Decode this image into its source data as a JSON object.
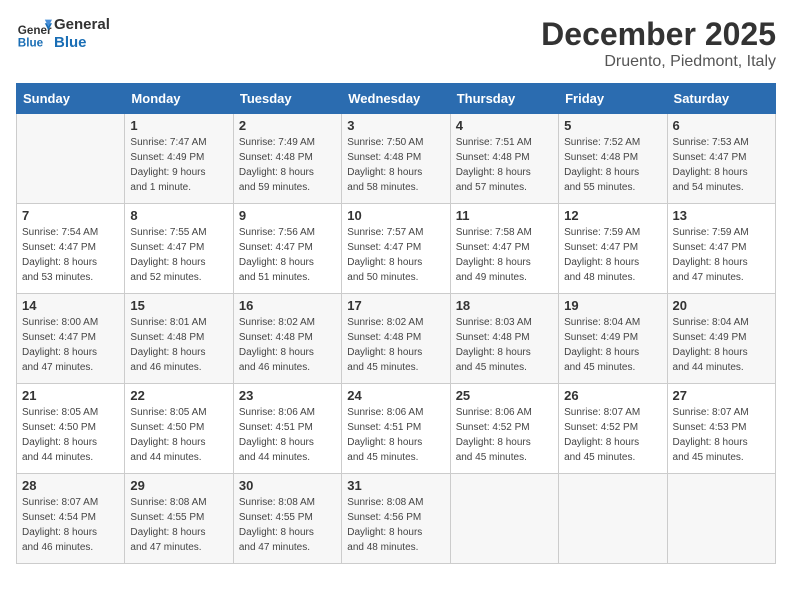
{
  "header": {
    "logo_text_general": "General",
    "logo_text_blue": "Blue",
    "month_title": "December 2025",
    "location": "Druento, Piedmont, Italy"
  },
  "days_of_week": [
    "Sunday",
    "Monday",
    "Tuesday",
    "Wednesday",
    "Thursday",
    "Friday",
    "Saturday"
  ],
  "weeks": [
    [
      {
        "day": "",
        "info": ""
      },
      {
        "day": "1",
        "info": "Sunrise: 7:47 AM\nSunset: 4:49 PM\nDaylight: 9 hours\nand 1 minute."
      },
      {
        "day": "2",
        "info": "Sunrise: 7:49 AM\nSunset: 4:48 PM\nDaylight: 8 hours\nand 59 minutes."
      },
      {
        "day": "3",
        "info": "Sunrise: 7:50 AM\nSunset: 4:48 PM\nDaylight: 8 hours\nand 58 minutes."
      },
      {
        "day": "4",
        "info": "Sunrise: 7:51 AM\nSunset: 4:48 PM\nDaylight: 8 hours\nand 57 minutes."
      },
      {
        "day": "5",
        "info": "Sunrise: 7:52 AM\nSunset: 4:48 PM\nDaylight: 8 hours\nand 55 minutes."
      },
      {
        "day": "6",
        "info": "Sunrise: 7:53 AM\nSunset: 4:47 PM\nDaylight: 8 hours\nand 54 minutes."
      }
    ],
    [
      {
        "day": "7",
        "info": "Sunrise: 7:54 AM\nSunset: 4:47 PM\nDaylight: 8 hours\nand 53 minutes."
      },
      {
        "day": "8",
        "info": "Sunrise: 7:55 AM\nSunset: 4:47 PM\nDaylight: 8 hours\nand 52 minutes."
      },
      {
        "day": "9",
        "info": "Sunrise: 7:56 AM\nSunset: 4:47 PM\nDaylight: 8 hours\nand 51 minutes."
      },
      {
        "day": "10",
        "info": "Sunrise: 7:57 AM\nSunset: 4:47 PM\nDaylight: 8 hours\nand 50 minutes."
      },
      {
        "day": "11",
        "info": "Sunrise: 7:58 AM\nSunset: 4:47 PM\nDaylight: 8 hours\nand 49 minutes."
      },
      {
        "day": "12",
        "info": "Sunrise: 7:59 AM\nSunset: 4:47 PM\nDaylight: 8 hours\nand 48 minutes."
      },
      {
        "day": "13",
        "info": "Sunrise: 7:59 AM\nSunset: 4:47 PM\nDaylight: 8 hours\nand 47 minutes."
      }
    ],
    [
      {
        "day": "14",
        "info": "Sunrise: 8:00 AM\nSunset: 4:47 PM\nDaylight: 8 hours\nand 47 minutes."
      },
      {
        "day": "15",
        "info": "Sunrise: 8:01 AM\nSunset: 4:48 PM\nDaylight: 8 hours\nand 46 minutes."
      },
      {
        "day": "16",
        "info": "Sunrise: 8:02 AM\nSunset: 4:48 PM\nDaylight: 8 hours\nand 46 minutes."
      },
      {
        "day": "17",
        "info": "Sunrise: 8:02 AM\nSunset: 4:48 PM\nDaylight: 8 hours\nand 45 minutes."
      },
      {
        "day": "18",
        "info": "Sunrise: 8:03 AM\nSunset: 4:48 PM\nDaylight: 8 hours\nand 45 minutes."
      },
      {
        "day": "19",
        "info": "Sunrise: 8:04 AM\nSunset: 4:49 PM\nDaylight: 8 hours\nand 45 minutes."
      },
      {
        "day": "20",
        "info": "Sunrise: 8:04 AM\nSunset: 4:49 PM\nDaylight: 8 hours\nand 44 minutes."
      }
    ],
    [
      {
        "day": "21",
        "info": "Sunrise: 8:05 AM\nSunset: 4:50 PM\nDaylight: 8 hours\nand 44 minutes."
      },
      {
        "day": "22",
        "info": "Sunrise: 8:05 AM\nSunset: 4:50 PM\nDaylight: 8 hours\nand 44 minutes."
      },
      {
        "day": "23",
        "info": "Sunrise: 8:06 AM\nSunset: 4:51 PM\nDaylight: 8 hours\nand 44 minutes."
      },
      {
        "day": "24",
        "info": "Sunrise: 8:06 AM\nSunset: 4:51 PM\nDaylight: 8 hours\nand 45 minutes."
      },
      {
        "day": "25",
        "info": "Sunrise: 8:06 AM\nSunset: 4:52 PM\nDaylight: 8 hours\nand 45 minutes."
      },
      {
        "day": "26",
        "info": "Sunrise: 8:07 AM\nSunset: 4:52 PM\nDaylight: 8 hours\nand 45 minutes."
      },
      {
        "day": "27",
        "info": "Sunrise: 8:07 AM\nSunset: 4:53 PM\nDaylight: 8 hours\nand 45 minutes."
      }
    ],
    [
      {
        "day": "28",
        "info": "Sunrise: 8:07 AM\nSunset: 4:54 PM\nDaylight: 8 hours\nand 46 minutes."
      },
      {
        "day": "29",
        "info": "Sunrise: 8:08 AM\nSunset: 4:55 PM\nDaylight: 8 hours\nand 47 minutes."
      },
      {
        "day": "30",
        "info": "Sunrise: 8:08 AM\nSunset: 4:55 PM\nDaylight: 8 hours\nand 47 minutes."
      },
      {
        "day": "31",
        "info": "Sunrise: 8:08 AM\nSunset: 4:56 PM\nDaylight: 8 hours\nand 48 minutes."
      },
      {
        "day": "",
        "info": ""
      },
      {
        "day": "",
        "info": ""
      },
      {
        "day": "",
        "info": ""
      }
    ]
  ]
}
